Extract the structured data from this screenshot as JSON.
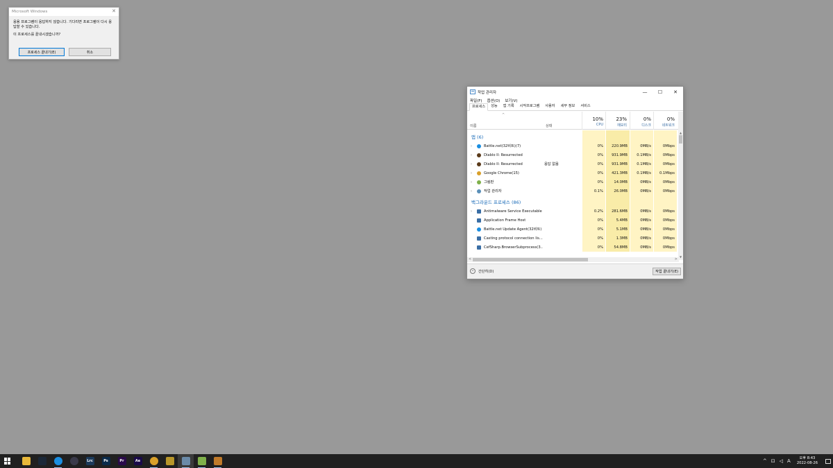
{
  "dialog": {
    "title": "Microsoft Windows",
    "message1": "응용 프로그램이 응답하지 않습니다. 기다리면 프로그램이 다시 응답할 수 있습니다.",
    "message2": "이 프로세스를 끝내시겠습니까?",
    "end_button": "프로세스 끝내기(E)",
    "cancel_button": "취소"
  },
  "taskmgr": {
    "title": "작업 관리자",
    "menu": [
      "파일(F)",
      "옵션(O)",
      "보기(V)"
    ],
    "tabs": [
      "프로세스",
      "성능",
      "앱 기록",
      "시작프로그램",
      "사용자",
      "세부 정보",
      "서비스"
    ],
    "columns": {
      "name": "이름",
      "status": "상태",
      "cpu_pct": "10%",
      "cpu": "CPU",
      "mem_pct": "23%",
      "mem": "메모리",
      "disk_pct": "0%",
      "disk": "디스크",
      "net_pct": "0%",
      "net": "네트워크"
    },
    "groups": {
      "apps": "앱 (6)",
      "background": "백그라운드 프로세스 (86)"
    },
    "apps": [
      {
        "name": "Battle.net(32비트)(7)",
        "status": "",
        "cpu": "0%",
        "mem": "220.9MB",
        "disk": "0MB/s",
        "net": "0Mbps",
        "icon": "battlenet-icon",
        "color": "#1a8ee1"
      },
      {
        "name": "Diablo II: Resurrected",
        "status": "",
        "cpu": "0%",
        "mem": "931.9MB",
        "disk": "0.1MB/s",
        "net": "0Mbps",
        "icon": "diablo-icon",
        "color": "#5a3a1a"
      },
      {
        "name": "Diablo II: Resurrected",
        "status": "응답 없음",
        "cpu": "0%",
        "mem": "931.9MB",
        "disk": "0.1MB/s",
        "net": "0Mbps",
        "icon": "diablo-icon",
        "color": "#5a3a1a"
      },
      {
        "name": "Google Chrome(15)",
        "status": "",
        "cpu": "0%",
        "mem": "421.3MB",
        "disk": "0.1MB/s",
        "net": "0.1Mbps",
        "icon": "chrome-icon",
        "color": "#d9a02a"
      },
      {
        "name": "그림판",
        "status": "",
        "cpu": "0%",
        "mem": "14.0MB",
        "disk": "0MB/s",
        "net": "0Mbps",
        "icon": "paint-icon",
        "color": "#7fb04a"
      },
      {
        "name": "작업 관리자",
        "status": "",
        "cpu": "0.1%",
        "mem": "26.0MB",
        "disk": "0MB/s",
        "net": "0Mbps",
        "icon": "taskmgr-icon",
        "color": "#5a8fb8"
      }
    ],
    "background": [
      {
        "name": "Antimalware Service Executable",
        "status": "",
        "cpu": "0.2%",
        "mem": "281.6MB",
        "disk": "0MB/s",
        "net": "0Mbps",
        "icon": "service-icon",
        "color": "#3a6ea5",
        "expandable": true
      },
      {
        "name": "Application Frame Host",
        "status": "",
        "cpu": "0%",
        "mem": "5.4MB",
        "disk": "0MB/s",
        "net": "0Mbps",
        "icon": "service-icon",
        "color": "#3a6ea5",
        "expandable": false
      },
      {
        "name": "Battle.net Update Agent(32비트)",
        "status": "",
        "cpu": "0%",
        "mem": "5.1MB",
        "disk": "0MB/s",
        "net": "0Mbps",
        "icon": "battlenet-icon",
        "color": "#1a8ee1",
        "expandable": false
      },
      {
        "name": "Casting protocol connection lis...",
        "status": "",
        "cpu": "0%",
        "mem": "1.3MB",
        "disk": "0MB/s",
        "net": "0Mbps",
        "icon": "service-icon",
        "color": "#3a6ea5",
        "expandable": false
      },
      {
        "name": "CefSharp.BrowserSubprocess(3...",
        "status": "",
        "cpu": "0%",
        "mem": "54.8MB",
        "disk": "0MB/s",
        "net": "0Mbps",
        "icon": "service-icon",
        "color": "#3a6ea5",
        "expandable": false
      }
    ],
    "fewer_details": "간단히(D)",
    "end_task": "작업 끝내기(E)"
  },
  "taskbar": {
    "apps": [
      {
        "icon": "file-explorer-icon",
        "label": "",
        "color": "#e8b83a",
        "running": false
      },
      {
        "icon": "steam-icon",
        "label": "",
        "color": "#1b2838",
        "running": false
      },
      {
        "icon": "battlenet-icon",
        "label": "",
        "color": "#1a8ee1",
        "running": true
      },
      {
        "icon": "obs-icon",
        "label": "",
        "color": "#3a3a4a",
        "running": false
      },
      {
        "icon": "lightroom-icon",
        "label": "Lrc",
        "color": "#1c3a5a",
        "running": false
      },
      {
        "icon": "photoshop-icon",
        "label": "Ps",
        "color": "#0a2a4a",
        "running": false
      },
      {
        "icon": "premiere-icon",
        "label": "Pr",
        "color": "#2a0a4a",
        "running": false
      },
      {
        "icon": "aftereffects-icon",
        "label": "Ae",
        "color": "#1a0a4a",
        "running": false
      },
      {
        "icon": "chrome-icon",
        "label": "",
        "color": "#d9a02a",
        "running": true
      },
      {
        "icon": "league-icon",
        "label": "",
        "color": "#b8962a",
        "running": false
      },
      {
        "icon": "taskmgr-icon",
        "label": "",
        "color": "#6a8aa8",
        "running": true,
        "active": true
      },
      {
        "icon": "paint-icon",
        "label": "",
        "color": "#7fb04a",
        "running": true
      },
      {
        "icon": "diablo-icon",
        "label": "",
        "color": "#c07a2a",
        "running": true
      }
    ],
    "tray": {
      "ime": "A",
      "time": "오후 8:43",
      "date": "2022-08-26"
    }
  }
}
